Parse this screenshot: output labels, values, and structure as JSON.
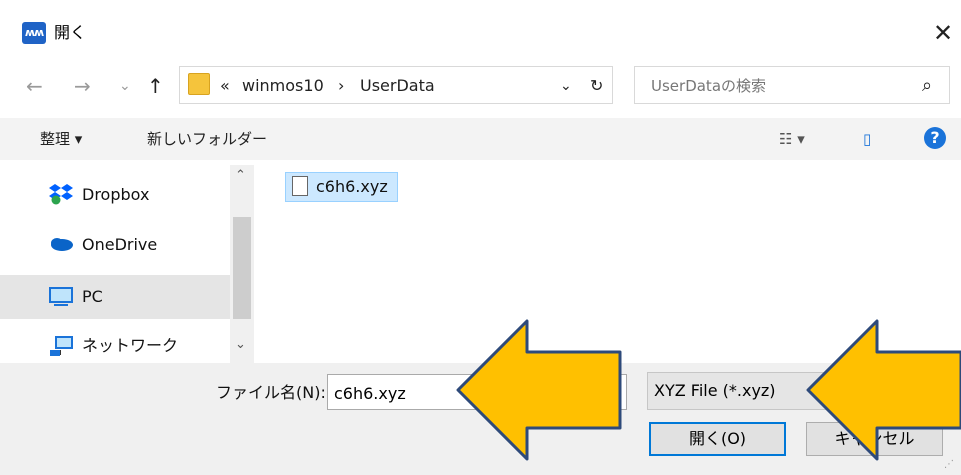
{
  "window": {
    "title": "開く",
    "close_glyph": "✕",
    "app_icon_text": "ʍʍ"
  },
  "nav": {
    "back_glyph": "←",
    "forward_glyph": "→",
    "recent_glyph": "⌄",
    "up_glyph": "↑",
    "breadcrumb": [
      "«",
      "winmos10",
      "›",
      "UserData"
    ],
    "dropdown_glyph": "⌄",
    "refresh_glyph": "↻",
    "search_placeholder": "UserDataの検索",
    "search_glyph": "⌕"
  },
  "toolbar": {
    "organize": "整理 ▾",
    "new_folder": "新しいフォルダー",
    "view_glyph": "☷ ▾",
    "preview_glyph": "▯",
    "help_glyph": "?"
  },
  "sidebar": {
    "scroll_up": "⌃",
    "scroll_down": "⌄",
    "items": [
      {
        "label": "Dropbox",
        "icon": "dropbox-icon",
        "selected": false
      },
      {
        "label": "OneDrive",
        "icon": "onedrive-icon",
        "selected": false
      },
      {
        "label": "PC",
        "icon": "pc-icon",
        "selected": true
      },
      {
        "label": "ネットワーク",
        "icon": "network-icon",
        "selected": false
      }
    ]
  },
  "files": [
    {
      "name": "c6h6.xyz",
      "selected": true
    }
  ],
  "bottom": {
    "filename_label": "ファイル名(N):",
    "filename_value": "c6h6.xyz",
    "filetype_value": "XYZ File (*.xyz)",
    "open_button": "開く(O)",
    "cancel_button": "キャンセル"
  },
  "colors": {
    "accent": "#0078d7",
    "highlight_arrow": "#ffc000",
    "arrow_outline": "#2e4a7a"
  }
}
